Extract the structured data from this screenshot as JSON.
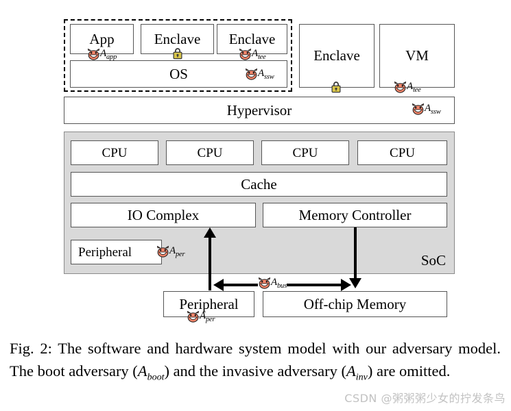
{
  "figure": {
    "caption_prefix": "Fig. 2:",
    "caption_part1": " The software and hardware system model with our adversary model. The boot adversary (",
    "caption_sym1": "A",
    "caption_sub1": "boot",
    "caption_part2": ") and the invasive adversary (",
    "caption_sym2": "A",
    "caption_sub2": "inv",
    "caption_part3": ") are omitted.",
    "watermark": "CSDN @粥粥粥少女的拧发条鸟"
  },
  "colors": {
    "soc_fill": "#d9d9d9",
    "box_border": "#555555",
    "devil_face": "#f4866b",
    "devil_outline": "#1a1a1a",
    "lock_body": "#d8c54a",
    "lock_shackle": "#3a3a3a",
    "watermark": "#c2c2c2"
  },
  "software": {
    "container_name": "software-stack",
    "boxes": [
      {
        "label": "App",
        "name": "app-box"
      },
      {
        "label": "Enclave",
        "name": "enclave-box-1"
      },
      {
        "label": "Enclave",
        "name": "enclave-box-2"
      },
      {
        "label": "OS",
        "name": "os-box"
      }
    ],
    "external": [
      {
        "label": "Enclave",
        "name": "enclave-box-3"
      },
      {
        "label": "VM",
        "name": "vm-box"
      }
    ],
    "hypervisor": {
      "label": "Hypervisor",
      "name": "hypervisor-box"
    }
  },
  "hardware": {
    "soc_label": "SoC",
    "cpus": [
      {
        "label": "CPU"
      },
      {
        "label": "CPU"
      },
      {
        "label": "CPU"
      },
      {
        "label": "CPU"
      }
    ],
    "cache": {
      "label": "Cache"
    },
    "io_complex": {
      "label": "IO Complex"
    },
    "memory_controller": {
      "label": "Memory Controller"
    },
    "on_chip_peripheral": {
      "label": "Peripheral"
    },
    "off_chip_peripheral": {
      "label": "Peripheral"
    },
    "off_chip_memory": {
      "label": "Off-chip Memory"
    }
  },
  "adversaries": [
    {
      "id": "app",
      "symbol": "A",
      "subscript": "app",
      "icon": "devil-icon",
      "attached_to": "app-box"
    },
    {
      "id": "tee1",
      "symbol": "A",
      "subscript": "tee",
      "icon": "devil-icon",
      "attached_to": "enclave-box-2"
    },
    {
      "id": "ssw1",
      "symbol": "A",
      "subscript": "ssw",
      "icon": "devil-icon",
      "attached_to": "os-box"
    },
    {
      "id": "tee2",
      "symbol": "A",
      "subscript": "tee",
      "icon": "devil-icon",
      "attached_to": "vm-box"
    },
    {
      "id": "ssw2",
      "symbol": "A",
      "subscript": "ssw",
      "icon": "devil-icon",
      "attached_to": "hypervisor-box"
    },
    {
      "id": "per1",
      "symbol": "A",
      "subscript": "per",
      "icon": "devil-icon",
      "attached_to": "on-chip-peripheral-box"
    },
    {
      "id": "bus",
      "symbol": "A",
      "subscript": "bus",
      "icon": "devil-icon",
      "attached_to": "bus-arrow"
    },
    {
      "id": "per2",
      "symbol": "A",
      "subscript": "per",
      "icon": "devil-icon",
      "attached_to": "off-chip-peripheral-box"
    }
  ],
  "locks": [
    {
      "id": "lock-enclave-1",
      "icon": "lock-icon",
      "attached_to": "enclave-box-1"
    },
    {
      "id": "lock-enclave-3",
      "icon": "lock-icon",
      "attached_to": "enclave-box-3"
    }
  ]
}
